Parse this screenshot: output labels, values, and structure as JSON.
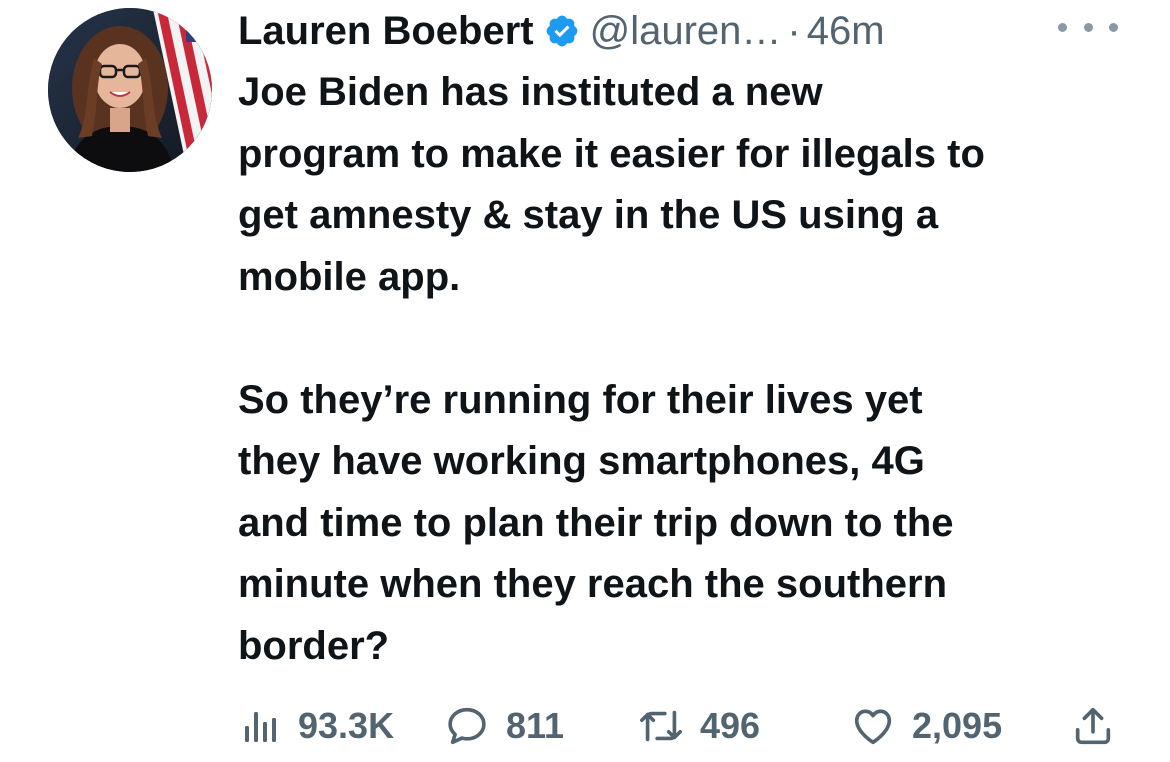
{
  "author": {
    "name": "Lauren Boebert",
    "handle": "@lauren…",
    "separator": "·",
    "time": "46m"
  },
  "icons": {
    "verified": "verified-badge-icon",
    "more": "more-options-icon",
    "views": "views-bar-chart-icon",
    "reply": "reply-bubble-icon",
    "retweet": "retweet-icon",
    "like": "heart-icon",
    "share": "share-upload-icon"
  },
  "colors": {
    "verified": "#1d9bf0",
    "text": "#0f1419",
    "muted": "#536471"
  },
  "tweet": {
    "paragraph_1": "Joe Biden has instituted a new\nprogram to make it easier for illegals to\nget amnesty & stay in the US using a\nmobile app.",
    "paragraph_2": "So they’re running for their lives yet\nthey have working smartphones, 4G\nand time to plan their trip down to the\nminute when they reach the southern\nborder?"
  },
  "metrics": {
    "views": "93.3K",
    "replies": "811",
    "retweets": "496",
    "likes": "2,095"
  }
}
